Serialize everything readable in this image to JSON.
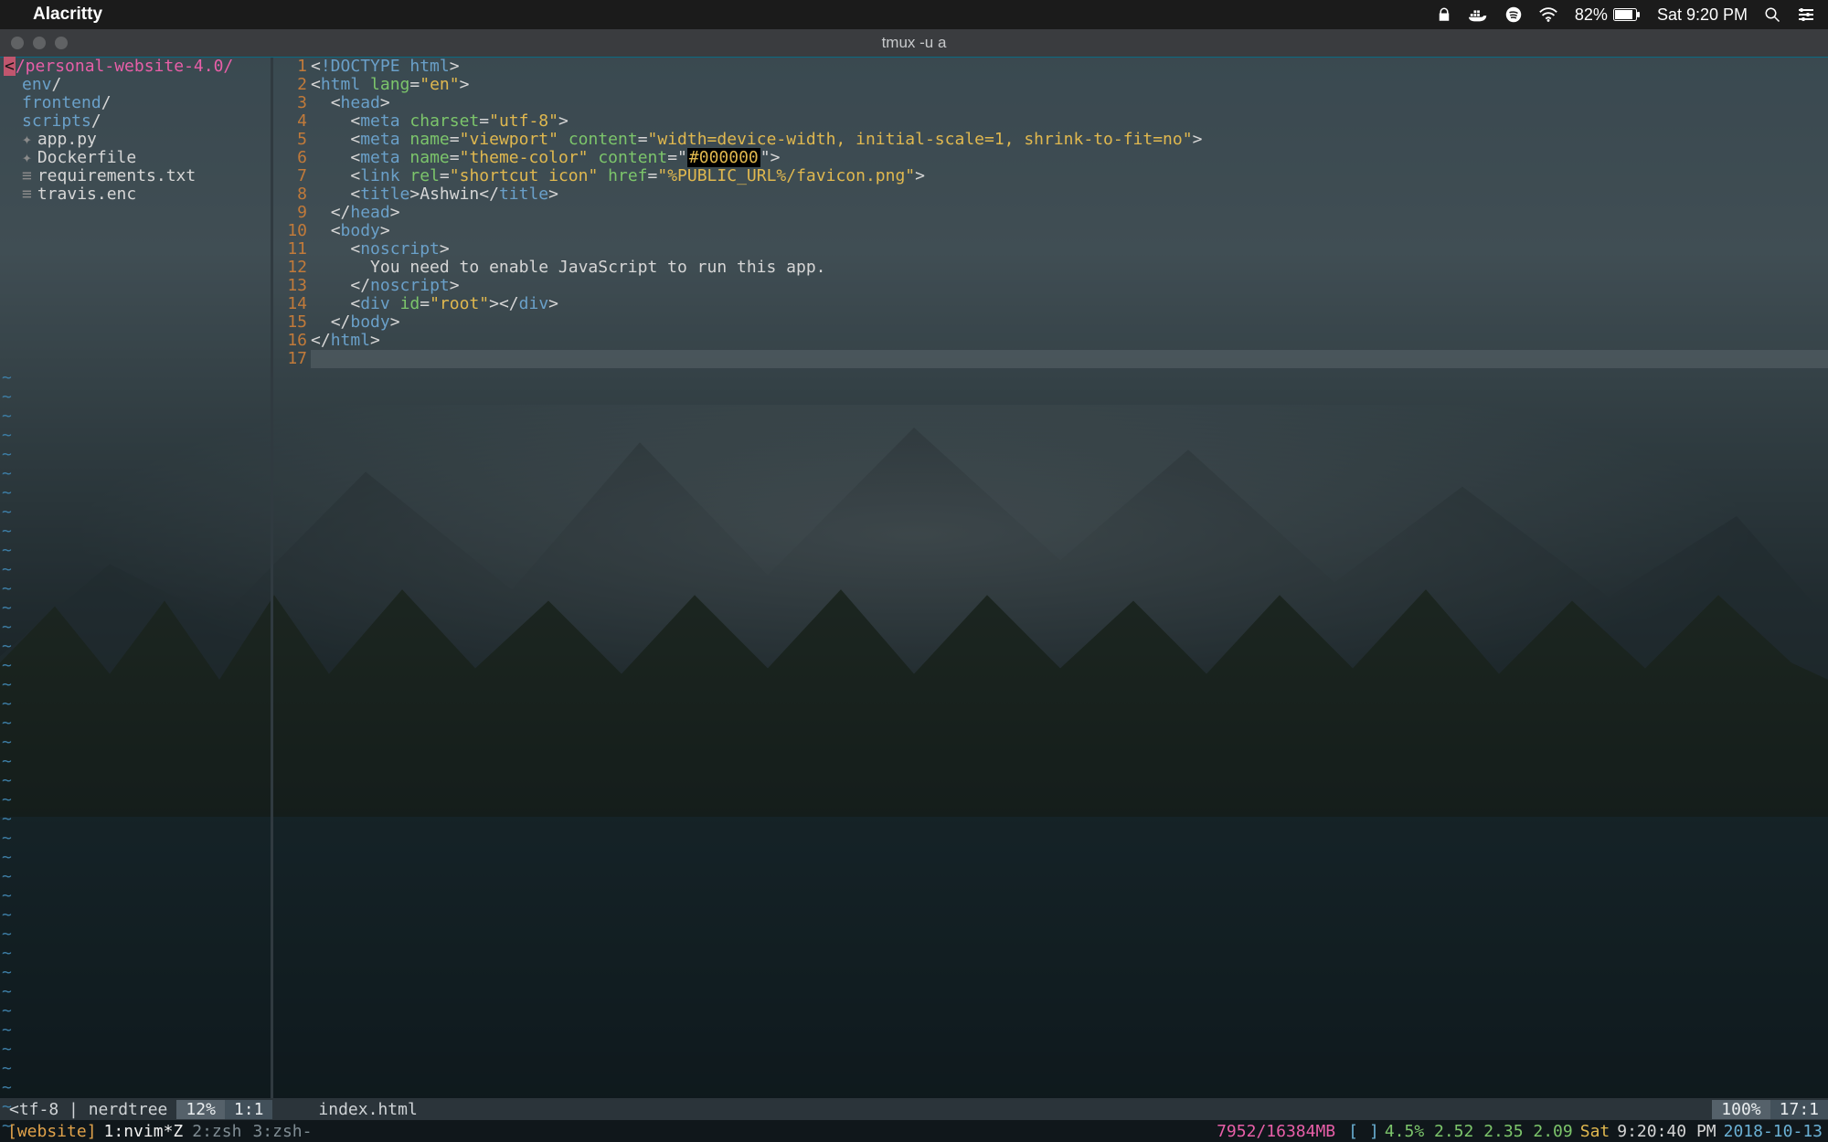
{
  "menubar": {
    "app_name": "Alacritty",
    "battery_pct": "82%",
    "clock": "Sat 9:20 PM"
  },
  "window": {
    "title": "tmux -u a"
  },
  "sidebar": {
    "root": "/personal-website-4.0/",
    "items": [
      {
        "type": "dir",
        "name": "env",
        "label": "env"
      },
      {
        "type": "dir",
        "name": "frontend",
        "label": "frontend"
      },
      {
        "type": "dir",
        "name": "scripts",
        "label": "scripts"
      },
      {
        "type": "file",
        "name": "app.py",
        "label": "app.py",
        "bullet": "✦"
      },
      {
        "type": "file",
        "name": "Dockerfile",
        "label": "Dockerfile",
        "bullet": "✦"
      },
      {
        "type": "file",
        "name": "requirements.txt",
        "label": "requirements.txt",
        "bullet": "≡"
      },
      {
        "type": "file",
        "name": "travis.enc",
        "label": "travis.enc",
        "bullet": "≡"
      }
    ]
  },
  "editor": {
    "filename": "index.html",
    "lines": [
      {
        "n": 1,
        "tokens": [
          {
            "c": "pun",
            "t": "<"
          },
          {
            "c": "doctype",
            "t": "!DOCTYPE html"
          },
          {
            "c": "pun",
            "t": ">"
          }
        ]
      },
      {
        "n": 2,
        "tokens": [
          {
            "c": "pun",
            "t": "<"
          },
          {
            "c": "tag",
            "t": "html"
          },
          {
            "c": "txt",
            "t": " "
          },
          {
            "c": "attr",
            "t": "lang"
          },
          {
            "c": "pun",
            "t": "="
          },
          {
            "c": "str",
            "t": "\"en\""
          },
          {
            "c": "pun",
            "t": ">"
          }
        ]
      },
      {
        "n": 3,
        "tokens": [
          {
            "c": "txt",
            "t": "  "
          },
          {
            "c": "pun",
            "t": "<"
          },
          {
            "c": "tag",
            "t": "head"
          },
          {
            "c": "pun",
            "t": ">"
          }
        ]
      },
      {
        "n": 4,
        "tokens": [
          {
            "c": "txt",
            "t": "    "
          },
          {
            "c": "pun",
            "t": "<"
          },
          {
            "c": "tag",
            "t": "meta"
          },
          {
            "c": "txt",
            "t": " "
          },
          {
            "c": "attr",
            "t": "charset"
          },
          {
            "c": "pun",
            "t": "="
          },
          {
            "c": "str",
            "t": "\"utf-8\""
          },
          {
            "c": "pun",
            "t": ">"
          }
        ]
      },
      {
        "n": 5,
        "tokens": [
          {
            "c": "txt",
            "t": "    "
          },
          {
            "c": "pun",
            "t": "<"
          },
          {
            "c": "tag",
            "t": "meta"
          },
          {
            "c": "txt",
            "t": " "
          },
          {
            "c": "attr",
            "t": "name"
          },
          {
            "c": "pun",
            "t": "="
          },
          {
            "c": "str",
            "t": "\"viewport\""
          },
          {
            "c": "txt",
            "t": " "
          },
          {
            "c": "attr",
            "t": "content"
          },
          {
            "c": "pun",
            "t": "="
          },
          {
            "c": "str",
            "t": "\"width=device-width, initial-scale=1, shrink-to-fit=no\""
          },
          {
            "c": "pun",
            "t": ">"
          }
        ]
      },
      {
        "n": 6,
        "tokens": [
          {
            "c": "txt",
            "t": "    "
          },
          {
            "c": "pun",
            "t": "<"
          },
          {
            "c": "tag",
            "t": "meta"
          },
          {
            "c": "txt",
            "t": " "
          },
          {
            "c": "attr",
            "t": "name"
          },
          {
            "c": "pun",
            "t": "="
          },
          {
            "c": "str",
            "t": "\"theme-color\""
          },
          {
            "c": "txt",
            "t": " "
          },
          {
            "c": "attr",
            "t": "content"
          },
          {
            "c": "pun",
            "t": "=\""
          },
          {
            "c": "hex",
            "t": "#000000"
          },
          {
            "c": "pun",
            "t": "\">"
          }
        ]
      },
      {
        "n": 7,
        "tokens": [
          {
            "c": "txt",
            "t": "    "
          },
          {
            "c": "pun",
            "t": "<"
          },
          {
            "c": "tag",
            "t": "link"
          },
          {
            "c": "txt",
            "t": " "
          },
          {
            "c": "attr",
            "t": "rel"
          },
          {
            "c": "pun",
            "t": "="
          },
          {
            "c": "str",
            "t": "\"shortcut icon\""
          },
          {
            "c": "txt",
            "t": " "
          },
          {
            "c": "attr",
            "t": "href"
          },
          {
            "c": "pun",
            "t": "="
          },
          {
            "c": "str",
            "t": "\"%PUBLIC_URL%/favicon.png\""
          },
          {
            "c": "pun",
            "t": ">"
          }
        ]
      },
      {
        "n": 8,
        "tokens": [
          {
            "c": "txt",
            "t": "    "
          },
          {
            "c": "pun",
            "t": "<"
          },
          {
            "c": "tag",
            "t": "title"
          },
          {
            "c": "pun",
            "t": ">"
          },
          {
            "c": "txt",
            "t": "Ashwin"
          },
          {
            "c": "pun",
            "t": "</"
          },
          {
            "c": "tag",
            "t": "title"
          },
          {
            "c": "pun",
            "t": ">"
          }
        ]
      },
      {
        "n": 9,
        "tokens": [
          {
            "c": "txt",
            "t": "  "
          },
          {
            "c": "pun",
            "t": "</"
          },
          {
            "c": "tag",
            "t": "head"
          },
          {
            "c": "pun",
            "t": ">"
          }
        ]
      },
      {
        "n": 10,
        "tokens": [
          {
            "c": "txt",
            "t": "  "
          },
          {
            "c": "pun",
            "t": "<"
          },
          {
            "c": "tag",
            "t": "body"
          },
          {
            "c": "pun",
            "t": ">"
          }
        ]
      },
      {
        "n": 11,
        "tokens": [
          {
            "c": "txt",
            "t": "    "
          },
          {
            "c": "pun",
            "t": "<"
          },
          {
            "c": "tag",
            "t": "noscript"
          },
          {
            "c": "pun",
            "t": ">"
          }
        ]
      },
      {
        "n": 12,
        "tokens": [
          {
            "c": "txt",
            "t": "      You need to enable JavaScript to run this app."
          }
        ]
      },
      {
        "n": 13,
        "tokens": [
          {
            "c": "txt",
            "t": "    "
          },
          {
            "c": "pun",
            "t": "</"
          },
          {
            "c": "tag",
            "t": "noscript"
          },
          {
            "c": "pun",
            "t": ">"
          }
        ]
      },
      {
        "n": 14,
        "tokens": [
          {
            "c": "txt",
            "t": "    "
          },
          {
            "c": "pun",
            "t": "<"
          },
          {
            "c": "tag",
            "t": "div"
          },
          {
            "c": "txt",
            "t": " "
          },
          {
            "c": "attr",
            "t": "id"
          },
          {
            "c": "pun",
            "t": "="
          },
          {
            "c": "str",
            "t": "\"root\""
          },
          {
            "c": "pun",
            "t": "></"
          },
          {
            "c": "tag",
            "t": "div"
          },
          {
            "c": "pun",
            "t": ">"
          }
        ]
      },
      {
        "n": 15,
        "tokens": [
          {
            "c": "txt",
            "t": "  "
          },
          {
            "c": "pun",
            "t": "</"
          },
          {
            "c": "tag",
            "t": "body"
          },
          {
            "c": "pun",
            "t": ">"
          }
        ]
      },
      {
        "n": 16,
        "tokens": [
          {
            "c": "pun",
            "t": "</"
          },
          {
            "c": "tag",
            "t": "html"
          },
          {
            "c": "pun",
            "t": ">"
          }
        ]
      },
      {
        "n": 17,
        "tokens": []
      }
    ],
    "cursor_line": 17
  },
  "vim_status": {
    "left1": "<tf-8 | nerdtree",
    "pct": "12%",
    "pos_left": "1:1",
    "filename": "index.html",
    "pct_right": "100%",
    "pos_right": "17:1"
  },
  "tmux": {
    "session": "[website]",
    "windows": [
      {
        "idx": "1",
        "label": "1:nvim*Z",
        "active": true
      },
      {
        "idx": "2",
        "label": "2:zsh",
        "active": false
      },
      {
        "idx": "3",
        "label": "3:zsh-",
        "active": false
      }
    ],
    "mem": "7952/16384MB",
    "brack_l": "[",
    "brack_r": "]",
    "cpu": "4.5% 2.52 2.35 2.09",
    "day": "Sat",
    "time": "9:20:40 PM",
    "date": "2018-10-13"
  }
}
